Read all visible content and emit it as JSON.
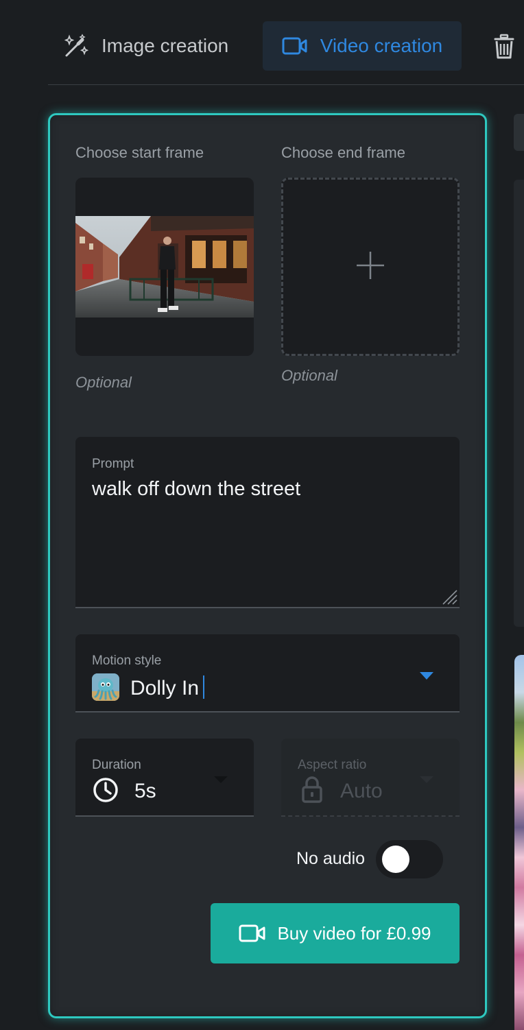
{
  "tabs": {
    "image_label": "Image creation",
    "video_label": "Video creation"
  },
  "frames": {
    "start_label": "Choose start frame",
    "end_label": "Choose end frame",
    "start_optional": "Optional",
    "end_optional": "Optional"
  },
  "prompt": {
    "label": "Prompt",
    "value": "walk off down the street"
  },
  "motion": {
    "label": "Motion style",
    "value": "Dolly In"
  },
  "duration": {
    "label": "Duration",
    "value": "5s"
  },
  "aspect": {
    "label": "Aspect ratio",
    "value": "Auto"
  },
  "audio": {
    "label": "No audio",
    "enabled": false
  },
  "buy": {
    "label": "Buy video for £0.99"
  },
  "colors": {
    "accent": "#2ec9c0",
    "active_tab": "#2f88e0",
    "buy_button": "#1aab9c"
  },
  "icons": [
    "magic-wand-icon",
    "video-camera-icon",
    "trash-icon",
    "plus-icon",
    "clock-icon",
    "lock-icon",
    "octopus-avatar-icon"
  ]
}
